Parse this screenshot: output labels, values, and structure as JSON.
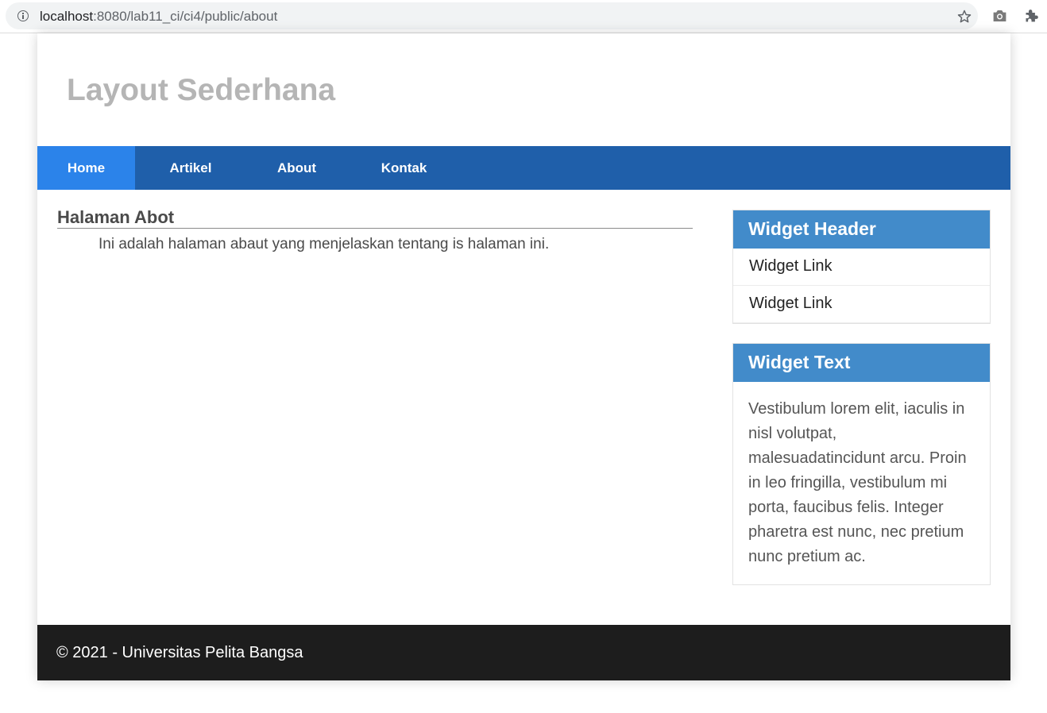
{
  "browser": {
    "url_host": "localhost",
    "url_rest": ":8080/lab11_ci/ci4/public/about"
  },
  "site": {
    "title": "Layout Sederhana"
  },
  "nav": {
    "items": [
      {
        "label": "Home",
        "active": true
      },
      {
        "label": "Artikel",
        "active": false
      },
      {
        "label": "About",
        "active": false
      },
      {
        "label": "Kontak",
        "active": false
      }
    ]
  },
  "main": {
    "heading": "Halaman Abot",
    "text": "Ini adalah halaman abaut yang menjelaskan tentang is halaman ini."
  },
  "widgets": {
    "links": {
      "header": "Widget Header",
      "items": [
        "Widget Link",
        "Widget Link"
      ]
    },
    "text": {
      "header": "Widget Text",
      "body": "Vestibulum lorem elit, iaculis in nisl volutpat, malesuadatincidunt arcu. Proin in leo fringilla, vestibulum mi porta, faucibus felis. Integer pharetra est nunc, nec pretium nunc pretium ac."
    }
  },
  "footer": {
    "text": "© 2021 - Universitas Pelita Bangsa"
  },
  "colors": {
    "nav_bg": "#1f5faa",
    "nav_active": "#2b83ea",
    "widget_header": "#428bca",
    "footer_bg": "#1d1d1d",
    "title": "#b5b5b5"
  },
  "icons": [
    "info-icon",
    "star-icon",
    "camera-icon",
    "puzzle-icon"
  ]
}
